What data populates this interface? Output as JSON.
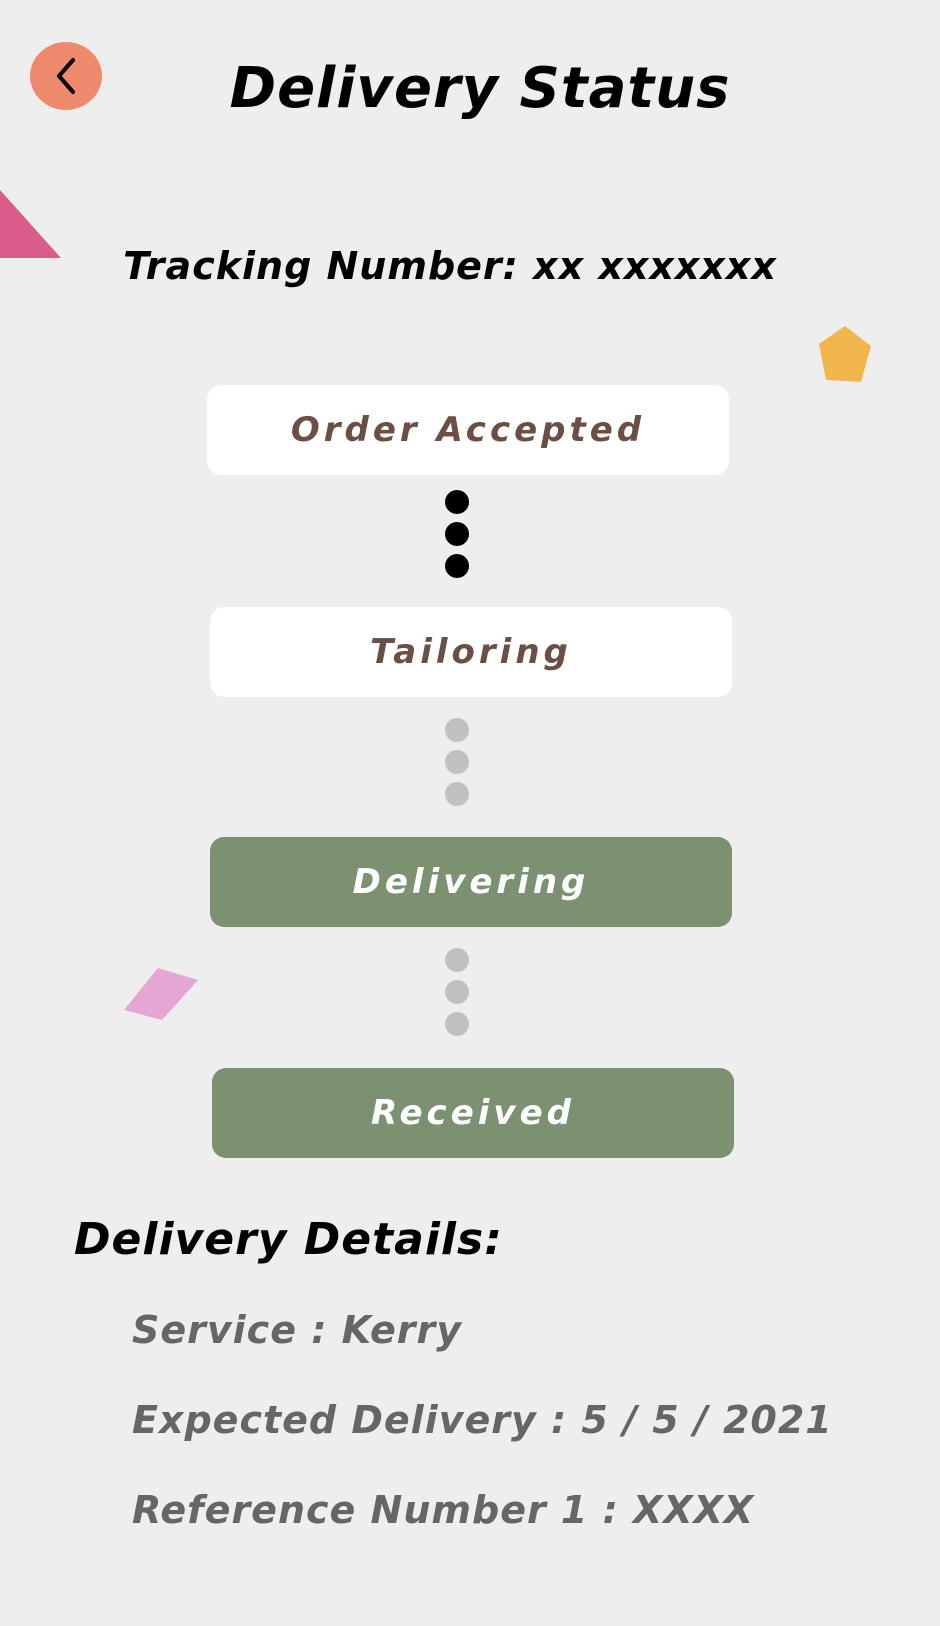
{
  "header": {
    "title": "Delivery Status",
    "back_icon": "chevron-left-icon"
  },
  "tracking": {
    "text": "Tracking Number: xx xxxxxxx"
  },
  "steps": [
    {
      "label": "Order Accepted",
      "state": "white"
    },
    {
      "label": "Tailoring",
      "state": "white"
    },
    {
      "label": "Delivering",
      "state": "green"
    },
    {
      "label": "Received",
      "state": "green"
    }
  ],
  "details": {
    "title": "Delivery Details:",
    "service": "Service : Kerry",
    "expected": "Expected Delivery : 5 / 5 / 2021",
    "reference": "Reference Number 1 : XXXX"
  },
  "colors": {
    "background": "#eeeeee",
    "back_button": "#ee8a6b",
    "step_white_text": "#6b4f45",
    "step_green": "#7c9170",
    "dot_done": "#000000",
    "dot_pending": "#c1c1c1",
    "deco_pink_triangle": "#d95c8a",
    "deco_orange_pentagon": "#f1b64d",
    "deco_lilac_diamond": "#e6a6d4"
  }
}
